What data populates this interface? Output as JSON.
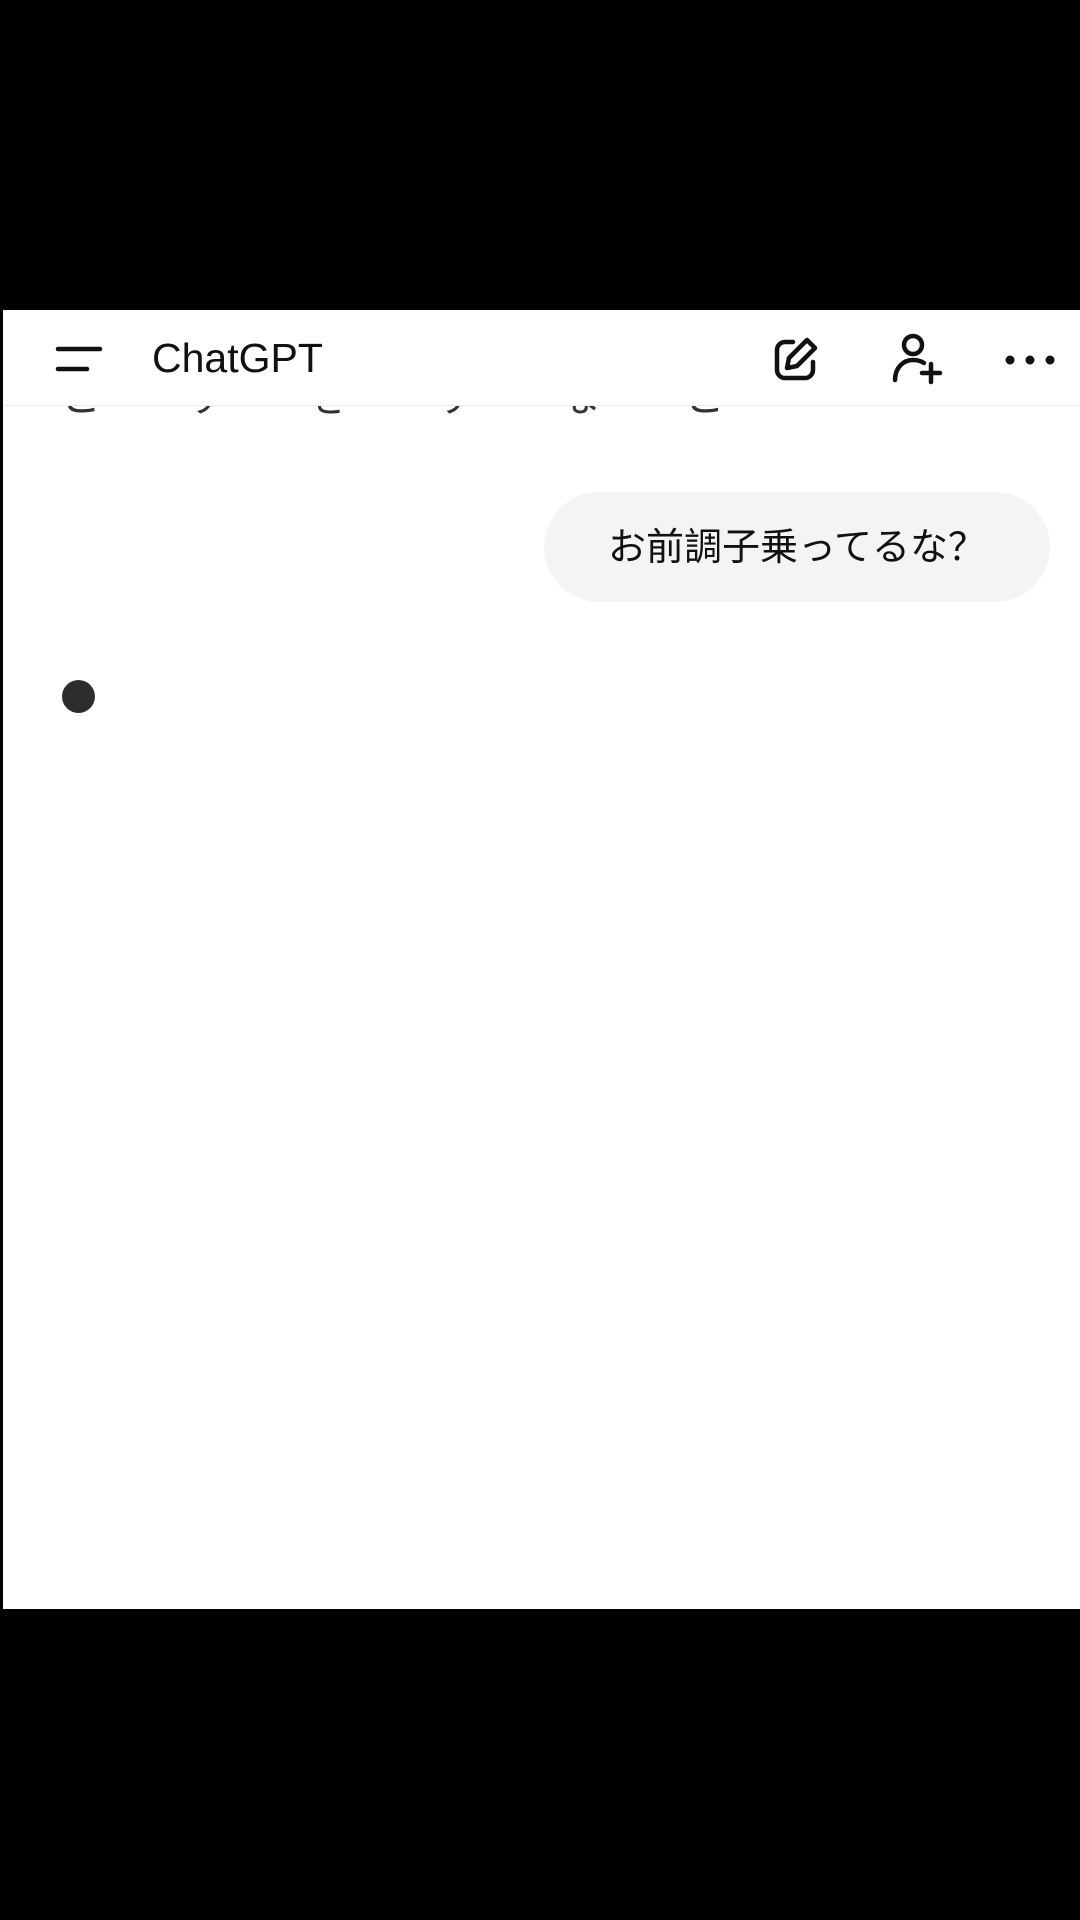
{
  "header": {
    "title": "ChatGPT",
    "menu_icon": "menu-icon",
    "new_chat_icon": "edit-icon",
    "add_person_icon": "add-person-icon",
    "more_icon": "more-horizontal-icon"
  },
  "conversation": {
    "cutoff_text": "こ す き す な こ",
    "user_message": "お前調子乗ってるな？",
    "assistant_state_icon": "typing-indicator-dot"
  },
  "colors": {
    "background": "#ffffff",
    "letterbox": "#000000",
    "bubble": "#f4f4f6",
    "text": "#111111",
    "dot": "#2d2d2d"
  }
}
